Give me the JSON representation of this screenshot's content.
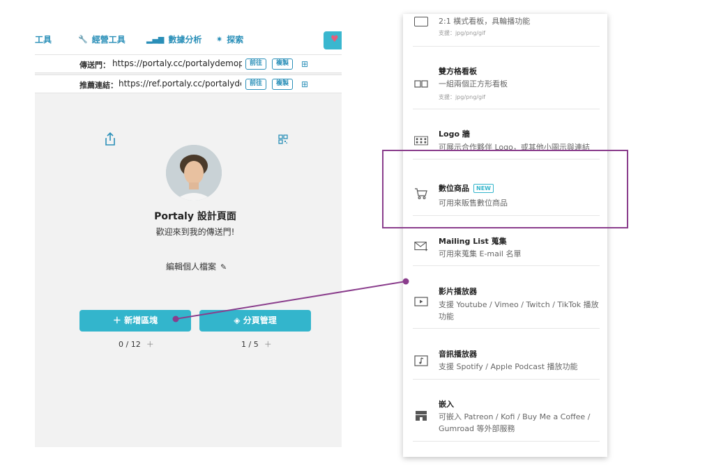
{
  "left_app": {
    "nav": {
      "tools": "工具",
      "operations": "經營工具",
      "analytics": "數據分析",
      "explore": "探索"
    },
    "portal_link": {
      "label": "傳送門：",
      "url": "https://portaly.cc/portalydemopa",
      "go": "前往",
      "copy": "複製"
    },
    "referral_link": {
      "label": "推薦連結：",
      "url": "https://ref.portaly.cc/portalyder",
      "go": "前往",
      "copy": "複製"
    },
    "profile": {
      "name": "Portaly 設計頁面",
      "bio": "歡迎來到我的傳送門!",
      "edit_label": "編輯個人檔案"
    },
    "add_block_button": "＋  新增區塊",
    "page_management_button": "分頁管理",
    "block_counter": "0 / 12",
    "page_counter": "1 / 5"
  },
  "block_menu": {
    "items": [
      {
        "title": "",
        "desc": "2:1 橫式看板，具輪播功能",
        "note": "支援：jpg/png/gif",
        "icon": "banner-icon"
      },
      {
        "title": "雙方格看板",
        "desc": "一組兩個正方形看板",
        "note": "支援：jpg/png/gif",
        "icon": "double-square-icon"
      },
      {
        "title": "Logo 牆",
        "desc": "可展示合作夥伴 Logo，或其他小圖示與連結",
        "note": "",
        "icon": "logo-wall-icon"
      },
      {
        "title": "數位商品",
        "badge": "NEW",
        "desc": "可用來販售數位商品",
        "note": "",
        "icon": "cart-icon"
      },
      {
        "title": "Mailing List 蒐集",
        "desc": "可用來蒐集 E-mail 名單",
        "note": "",
        "icon": "mail-icon"
      },
      {
        "title": "影片播放器",
        "desc": "支援 Youtube / Vimeo / Twitch / TikTok 播放功能",
        "note": "",
        "icon": "video-icon"
      },
      {
        "title": "音訊播放器",
        "desc": "支援 Spotify / Apple Podcast 播放功能",
        "note": "",
        "icon": "audio-icon"
      },
      {
        "title": "嵌入",
        "desc": "可嵌入 Patreon / Kofi / Buy Me a Coffee / Gumroad 等外部服務",
        "note": "",
        "icon": "store-icon"
      }
    ]
  },
  "colors": {
    "accent": "#33b5cc",
    "nav_text": "#2a8fb8",
    "highlight": "#8a3d8c",
    "panel_bg": "#f2f2f2"
  }
}
